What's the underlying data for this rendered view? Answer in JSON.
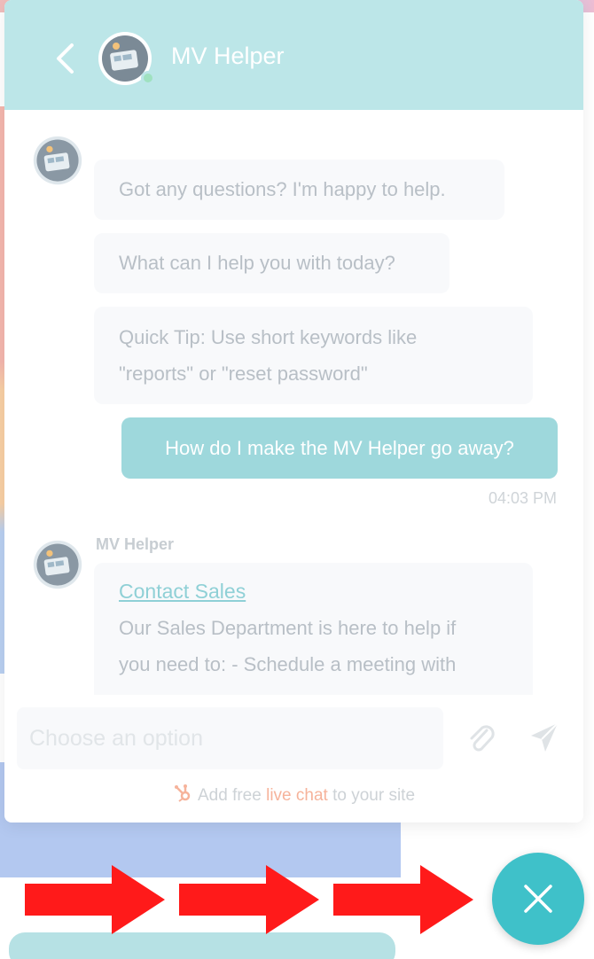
{
  "widget": {
    "title": "MV Helper",
    "back_icon": "chevron-left-icon",
    "avatar_icon": "bot-avatar-icon"
  },
  "messages": {
    "bot_1": "Got any questions? I'm happy to help.",
    "bot_2": "What can I help you with today?",
    "bot_3_line1": "Quick Tip: Use short keywords like",
    "bot_3_line2": "\"reports\" or \"reset password\"",
    "user_1": "How do I make the MV Helper go away?",
    "user_1_time": "04:03 PM",
    "bot_sender": "MV Helper",
    "bot_4_link": "Contact Sales",
    "bot_4_line1": "Our Sales Department is here to help if",
    "bot_4_line2": "you need to: - Schedule a meeting with"
  },
  "input": {
    "placeholder": "Choose an option",
    "attach_icon": "paperclip-icon",
    "send_icon": "send-icon"
  },
  "footer": {
    "prefix": "Add free ",
    "highlight": "live chat",
    "suffix": " to your site",
    "icon": "hubspot-sprocket-icon"
  },
  "close_button": {
    "icon": "close-icon"
  },
  "annotations": {
    "arrow_icon": "red-arrow-right-icon",
    "arrow_color": "#ff1a1a"
  },
  "colors": {
    "header_bg": "#bce6e8",
    "user_bubble": "#9ed8dc",
    "fab": "#3fc1c9",
    "link": "#8fd0d6",
    "footer_highlight": "#f6b39b"
  }
}
